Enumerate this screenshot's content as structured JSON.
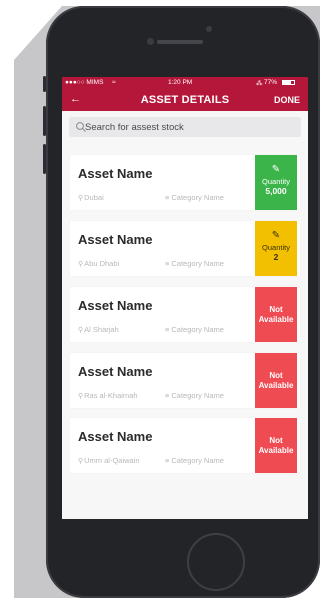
{
  "status": {
    "carrier": "●●●○○ MIMS",
    "wifi": "≈",
    "time": "1:20 PM",
    "battery": "77%"
  },
  "nav": {
    "back_icon": "←",
    "title": "ASSET DETAILS",
    "done": "DONE"
  },
  "search": {
    "placeholder": "Search for assest stock"
  },
  "colors": {
    "primary": "#b5173b",
    "quantity_green": "#3bb54a",
    "quantity_yellow": "#f2c000",
    "not_available": "#ef4b52"
  },
  "assets": [
    {
      "name": "Asset Name",
      "location": "Dubai",
      "category": "Category Name",
      "status_label": "Quantity",
      "status_value": "5,000",
      "status": "quantity_green"
    },
    {
      "name": "Asset Name",
      "location": "Abu Dhabi",
      "category": "Category Name",
      "status_label": "Quantity",
      "status_value": "2",
      "status": "quantity_yellow"
    },
    {
      "name": "Asset Name",
      "location": "Al Sharjah",
      "category": "Category Name",
      "status_label": "Not Available",
      "status": "not_available"
    },
    {
      "name": "Asset Name",
      "location": "Ras al-Khaimah",
      "category": "Category Name",
      "status_label": "Not Available",
      "status": "not_available"
    },
    {
      "name": "Asset Name",
      "location": "Umm al-Qaiwain",
      "category": "Category Name",
      "status_label": "Not Available",
      "status": "not_available"
    }
  ]
}
